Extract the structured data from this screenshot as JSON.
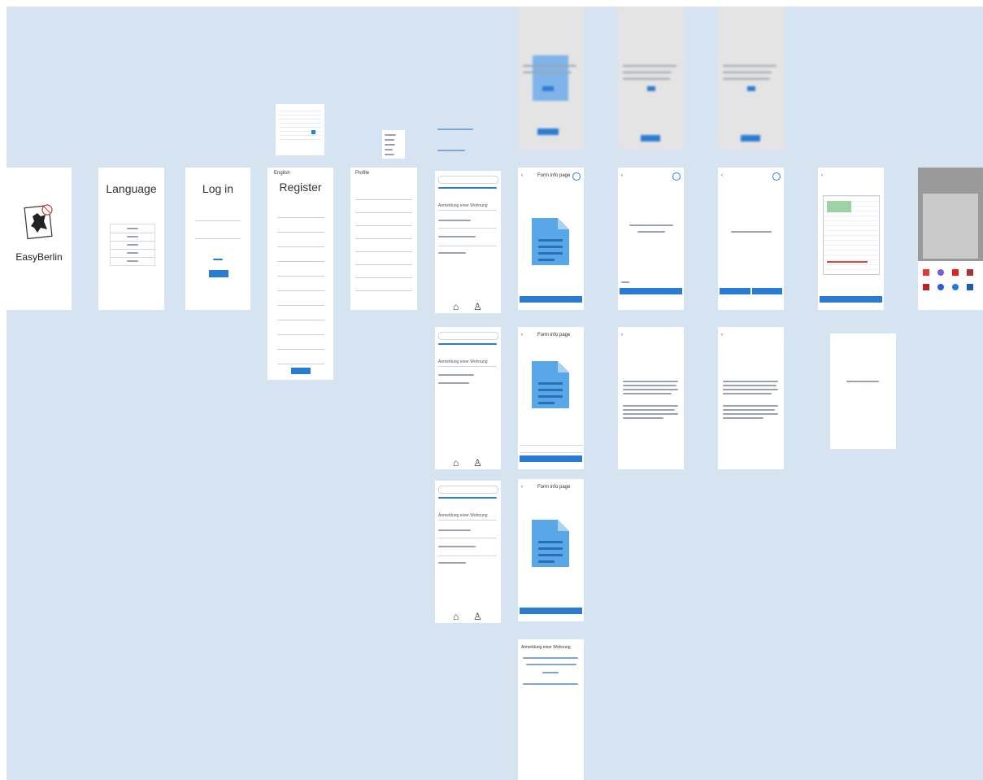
{
  "app": {
    "name": "EasyBerlin"
  },
  "language_screen": {
    "title": "Language"
  },
  "login_screen": {
    "title": "Log in"
  },
  "register_screen": {
    "title": "Register",
    "back_label": "English"
  },
  "profile_screen": {
    "back_label": "Profile"
  },
  "form_screens": {
    "title_1": "Form info page",
    "title_2": "Form info page",
    "title_3": "Form info page"
  },
  "list_items": [
    "Anmeldung einer Wohnung",
    "Anmeldung einer Wohnung",
    "Anmeldung einer Wohnung"
  ],
  "detail_screen": {
    "title": "Anmeldung einer Wohnung"
  },
  "colors": {
    "canvas": "#d6e4f2",
    "accent": "#2a7bd2",
    "doc": "#5aa7e8"
  }
}
